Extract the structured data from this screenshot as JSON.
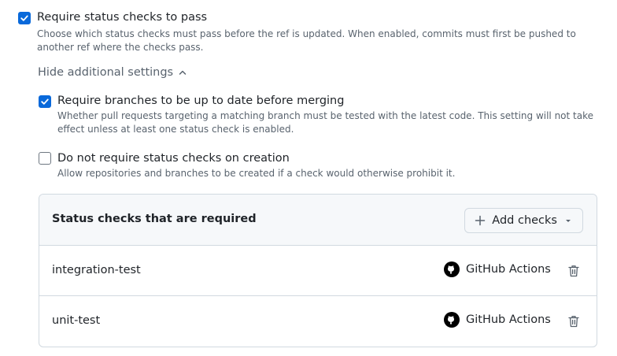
{
  "settings": {
    "require_status_checks": {
      "label": "Require status checks to pass",
      "description": "Choose which status checks must pass before the ref is updated. When enabled, commits must first be pushed to another ref where the checks pass.",
      "checked": true
    },
    "additional_toggle": {
      "label": "Hide additional settings",
      "icon": "chevron-up-icon"
    },
    "require_up_to_date": {
      "label": "Require branches to be up to date before merging",
      "description": "Whether pull requests targeting a matching branch must be tested with the latest code. This setting will not take effect unless at least one status check is enabled.",
      "checked": true
    },
    "skip_on_creation": {
      "label": "Do not require status checks on creation",
      "description": "Allow repositories and branches to be created if a check would otherwise prohibit it.",
      "checked": false
    }
  },
  "status_checks": {
    "title": "Status checks that are required",
    "add_button": {
      "label": "Add checks",
      "icon": "plus-icon",
      "dropdown_icon": "triangle-down-icon"
    },
    "rows": [
      {
        "name": "integration-test",
        "app": "GitHub Actions",
        "app_icon": "github-icon",
        "action_icon": "trash-icon"
      },
      {
        "name": "unit-test",
        "app": "GitHub Actions",
        "app_icon": "github-icon",
        "action_icon": "trash-icon"
      }
    ]
  },
  "colors": {
    "accent": "#0969da",
    "border": "#d1d9e0",
    "muted_text": "#59636e",
    "header_bg": "#f6f8fa"
  }
}
